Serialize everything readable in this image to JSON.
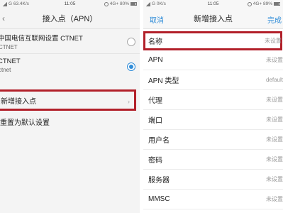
{
  "left": {
    "status": {
      "left_text": "G 63.4K/s",
      "time": "11:05",
      "right_text": "4G+ 80%"
    },
    "title": "接入点（APN）",
    "apns": [
      {
        "name": "中国电信互联网设置 CTNET",
        "sub": "CTNET",
        "selected": false
      },
      {
        "name": "CTNET",
        "sub": "ctnet",
        "selected": true
      }
    ],
    "add_label": "新增接入点",
    "reset_label": "重置为默认设置"
  },
  "right": {
    "status": {
      "left_text": "G 0K/s",
      "time": "11:05",
      "right_text": "4G+ 89%"
    },
    "cancel_label": "取消",
    "title": "新增接入点",
    "done_label": "完成",
    "fields": [
      {
        "label": "名称",
        "value": "未设置"
      },
      {
        "label": "APN",
        "value": "未设置"
      },
      {
        "label": "APN 类型",
        "value": "default"
      },
      {
        "label": "代理",
        "value": "未设置"
      },
      {
        "label": "端口",
        "value": "未设置"
      },
      {
        "label": "用户名",
        "value": "未设置"
      },
      {
        "label": "密码",
        "value": "未设置"
      },
      {
        "label": "服务器",
        "value": "未设置"
      },
      {
        "label": "MMSC",
        "value": "未设置"
      }
    ]
  },
  "colors": {
    "accent": "#2f8cd8",
    "highlight": "#b2202a"
  }
}
